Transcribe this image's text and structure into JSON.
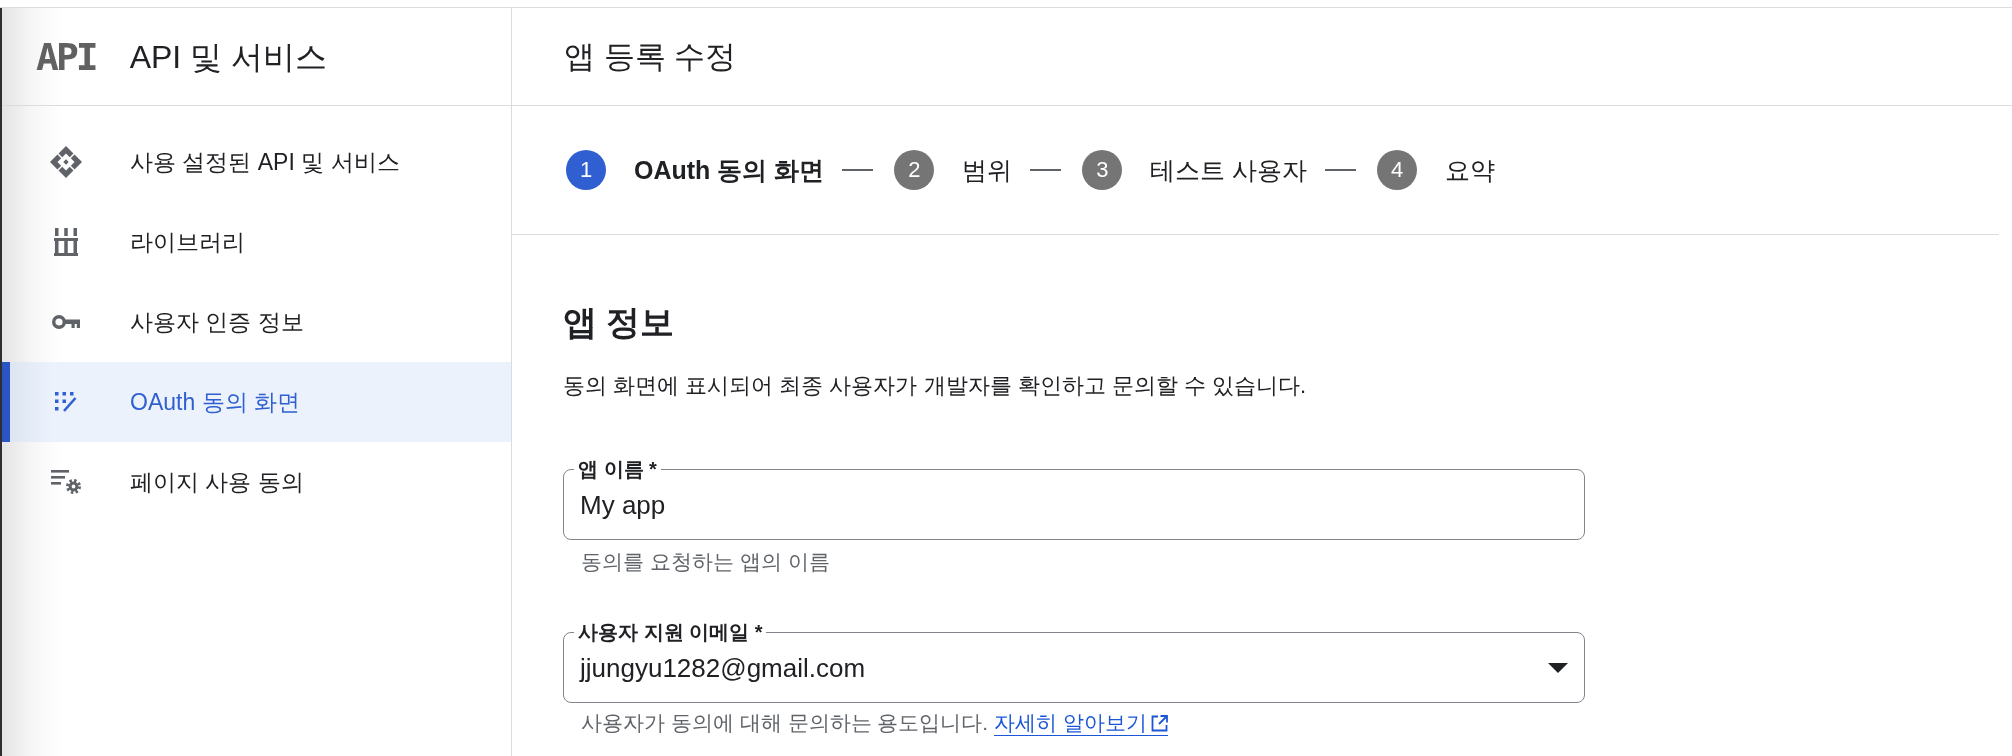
{
  "sidebar": {
    "logo": "API",
    "title": "API 및 서비스",
    "items": [
      {
        "label": "사용 설정된 API 및 서비스",
        "selected": false
      },
      {
        "label": "라이브러리",
        "selected": false
      },
      {
        "label": "사용자 인증 정보",
        "selected": false
      },
      {
        "label": "OAuth 동의 화면",
        "selected": true
      },
      {
        "label": "페이지 사용 동의",
        "selected": false
      }
    ]
  },
  "main": {
    "title": "앱 등록 수정",
    "steps": [
      {
        "number": "1",
        "label": "OAuth 동의 화면",
        "selected": true
      },
      {
        "number": "2",
        "label": "범위",
        "selected": false
      },
      {
        "number": "3",
        "label": "테스트 사용자",
        "selected": false
      },
      {
        "number": "4",
        "label": "요약",
        "selected": false
      }
    ],
    "section": {
      "title": "앱 정보",
      "description": "동의 화면에 표시되어 최종 사용자가 개발자를 확인하고 문의할 수 있습니다.",
      "fields": [
        {
          "kind": "text",
          "label": "앱 이름 *",
          "value": "My app",
          "helper": "동의를 요청하는 앱의 이름"
        },
        {
          "kind": "select",
          "label": "사용자 지원 이메일 *",
          "value": "jjungyu1282@gmail.com",
          "helper": "사용자가 동의에 대해 문의하는 용도입니다.",
          "link": "자세히 알아보기"
        }
      ]
    }
  }
}
